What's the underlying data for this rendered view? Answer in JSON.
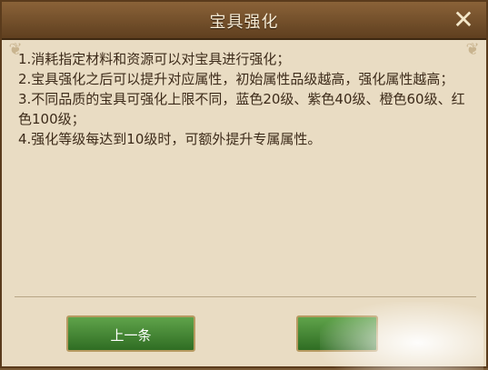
{
  "dialog": {
    "title": "宝具强化",
    "close_icon": "✕"
  },
  "content": {
    "lines": [
      "1.消耗指定材料和资源可以对宝具进行强化；",
      "2.宝具强化之后可以提升对应属性，初始属性品级越高，强化属性越高；",
      "3.不同品质的宝具可强化上限不同，蓝色20级、紫色40级、橙色60级、红色100级；",
      "4.强化等级每达到10级时，可额外提升专属属性。"
    ]
  },
  "buttons": {
    "prev_label": "上一条",
    "next_label": ""
  }
}
